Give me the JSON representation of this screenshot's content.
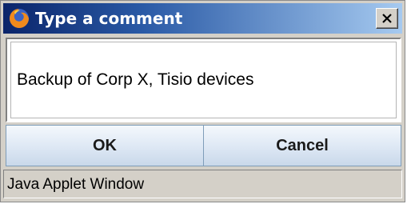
{
  "window": {
    "title": "Type a comment",
    "title_icon": "firefox-icon",
    "close_icon": "close-icon"
  },
  "comment": {
    "value": "Backup of Corp X, Tisio devices"
  },
  "buttons": {
    "ok_label": "OK",
    "cancel_label": "Cancel"
  },
  "status": {
    "text": "Java Applet Window"
  },
  "colors": {
    "titlebar_start": "#0a246a",
    "titlebar_end": "#a6caf0",
    "dialog_background": "#d4d0c8",
    "button_border": "#7f9db9"
  }
}
